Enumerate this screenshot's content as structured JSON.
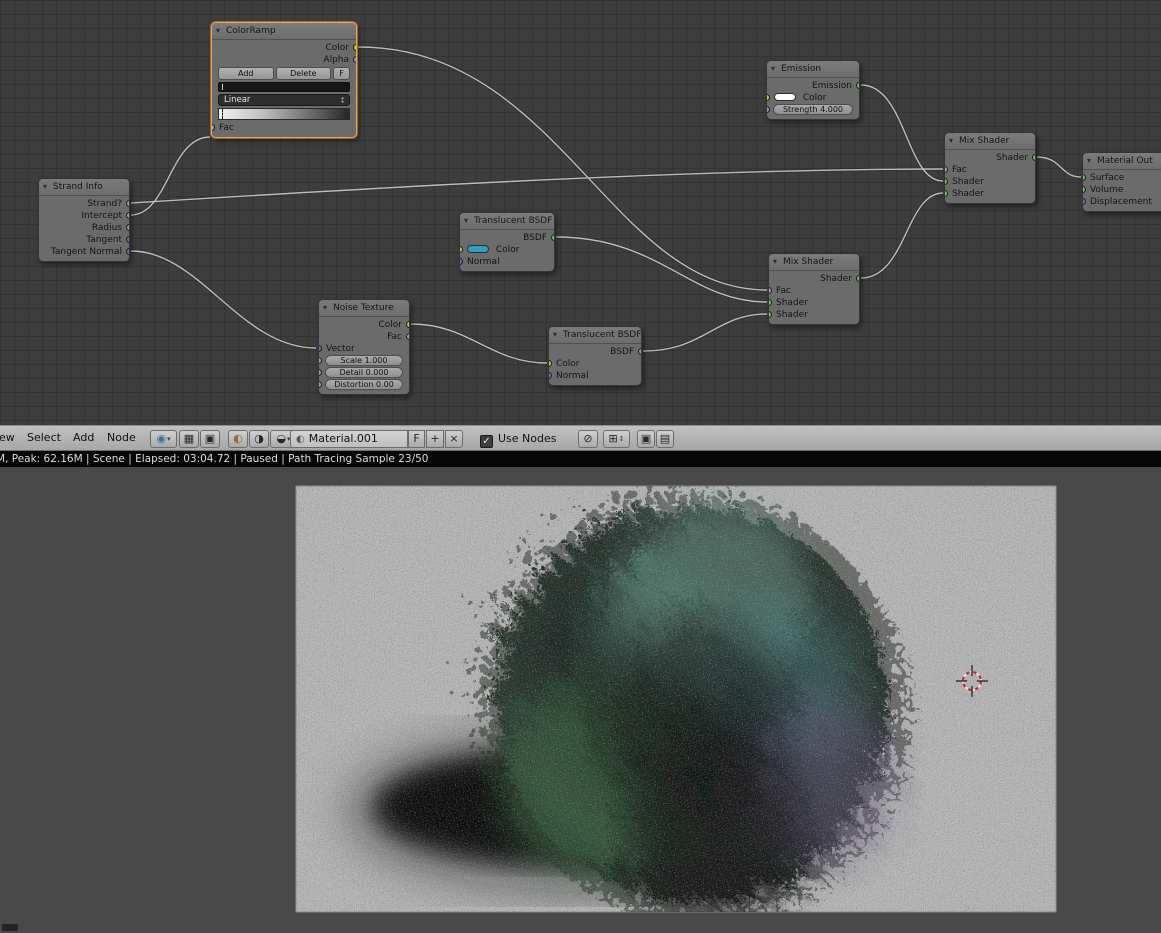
{
  "header": {
    "menus": [
      "ew",
      "Select",
      "Add",
      "Node"
    ],
    "material_name": "Material.001",
    "fake_user_label": "F",
    "use_nodes_label": "Use Nodes"
  },
  "status_text": "M, Peak: 62.16M | Scene | Elapsed: 03:04.72 | Paused | Path Tracing Sample 23/50",
  "icons": {
    "collapse": "▾",
    "editor_type": "◉",
    "grid": "▦",
    "pin": "▣",
    "material_ball": "◐",
    "texture_ball": "◑",
    "shading_ball": "◒",
    "dropdown": "↕",
    "dropdown_small": "▾",
    "field_ball": "◐",
    "add": "+",
    "close": "×",
    "check": "✓",
    "snap": "⊘",
    "background": "⊞",
    "copy": "▣",
    "paste": "▤"
  },
  "nodes": {
    "color_ramp": {
      "title": "ColorRamp",
      "out_color": "Color",
      "out_alpha": "Alpha",
      "btn_add": "Add",
      "btn_delete": "Delete",
      "btn_fake": "F",
      "interpolation": "Linear",
      "in_fac": "Fac"
    },
    "strand_info": {
      "title": "Strand Info",
      "outputs": [
        "Strand?",
        "Intercept",
        "Radius",
        "Tangent",
        "Tangent Normal"
      ]
    },
    "emission": {
      "title": "Emission",
      "out_emission": "Emission",
      "in_color": "Color",
      "in_strength": "Strength 4.000"
    },
    "translucent_top": {
      "title": "Translucent BSDF",
      "out_bsdf": "BSDF",
      "in_color": "Color",
      "in_normal": "Normal"
    },
    "noise_texture": {
      "title": "Noise Texture",
      "out_color": "Color",
      "out_fac": "Fac",
      "in_vector": "Vector",
      "scale": "Scale 1.000",
      "detail": "Detail 0.000",
      "distortion": "Distortion 0.00"
    },
    "translucent_bottom": {
      "title": "Translucent BSDF",
      "out_bsdf": "BSDF",
      "in_color": "Color",
      "in_normal": "Normal"
    },
    "mix_shader_left": {
      "title": "Mix Shader",
      "out_shader": "Shader",
      "in_fac": "Fac",
      "in_shader1": "Shader",
      "in_shader2": "Shader"
    },
    "mix_shader_right": {
      "title": "Mix Shader",
      "out_shader": "Shader",
      "in_fac": "Fac",
      "in_shader1": "Shader",
      "in_shader2": "Shader"
    },
    "material_output": {
      "title": "Material Out",
      "in_surface": "Surface",
      "in_volume": "Volume",
      "in_displacement": "Displacement"
    }
  },
  "colors": {
    "node_selected_border": "#f0a14b",
    "socket_shader": "#63c763",
    "socket_color": "#c7c729",
    "socket_vector": "#6e6ec7",
    "socket_value": "#a1a1a1",
    "emission_swatch": "#ffffff",
    "translucent_swatch": "#2f9fc0",
    "render_background": "#b6b6b6",
    "wire": "#bdbdbd"
  }
}
